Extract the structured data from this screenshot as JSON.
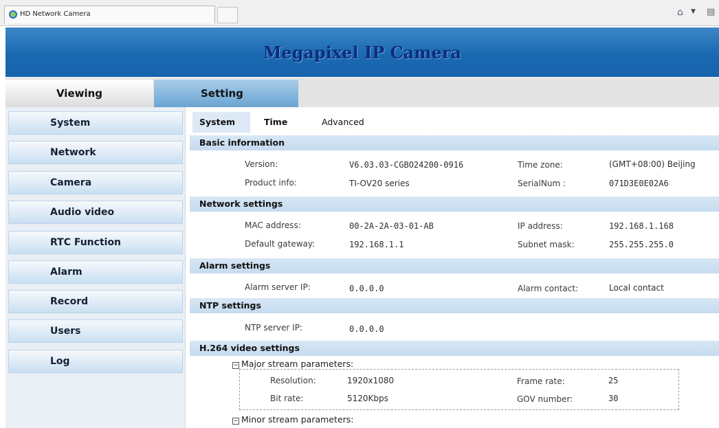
{
  "browser": {
    "tab_title": "HD Network Camera"
  },
  "banner": {
    "title": "Megapixel IP Camera"
  },
  "topnav": {
    "viewing": "Viewing",
    "setting": "Setting"
  },
  "sidebar": {
    "items": [
      {
        "label": "System"
      },
      {
        "label": "Network"
      },
      {
        "label": "Camera"
      },
      {
        "label": "Audio video"
      },
      {
        "label": "RTC Function"
      },
      {
        "label": "Alarm"
      },
      {
        "label": "Record"
      },
      {
        "label": "Users"
      },
      {
        "label": "Log"
      }
    ]
  },
  "subtabs": {
    "system": "System",
    "time": "Time",
    "advanced": "Advanced"
  },
  "basic": {
    "heading": "Basic information",
    "version_label": "Version:",
    "version": "V6.03.03-CGBO24200-0916",
    "timezone_label": "Time zone:",
    "timezone": "(GMT+08:00) Beijing",
    "product_label": "Product info:",
    "product": "TI-OV20 series",
    "serial_label": "SerialNum :",
    "serial": "071D3E0E02A6"
  },
  "network": {
    "heading": "Network settings",
    "mac_label": "MAC address:",
    "mac": "00-2A-2A-03-01-AB",
    "ip_label": "IP address:",
    "ip": "192.168.1.168",
    "gateway_label": "Default gateway:",
    "gateway": "192.168.1.1",
    "mask_label": "Subnet mask:",
    "mask": "255.255.255.0"
  },
  "alarm": {
    "heading": "Alarm settings",
    "server_label": "Alarm server IP:",
    "server": "0.0.0.0",
    "contact_label": "Alarm contact:",
    "contact": "Local contact"
  },
  "ntp": {
    "heading": "NTP settings",
    "server_label": "NTP server IP:",
    "server": "0.0.0.0"
  },
  "video": {
    "heading": "H.264 video settings",
    "major": {
      "title": "Major stream parameters:",
      "toggle": "−",
      "resolution_label": "Resolution:",
      "resolution": "1920x1080",
      "framerate_label": "Frame rate:",
      "framerate": "25",
      "bitrate_label": "Bit rate:",
      "bitrate": "5120Kbps",
      "gov_label": "GOV number:",
      "gov": "30"
    },
    "minor": {
      "title": "Minor stream parameters:",
      "toggle": "−"
    }
  }
}
